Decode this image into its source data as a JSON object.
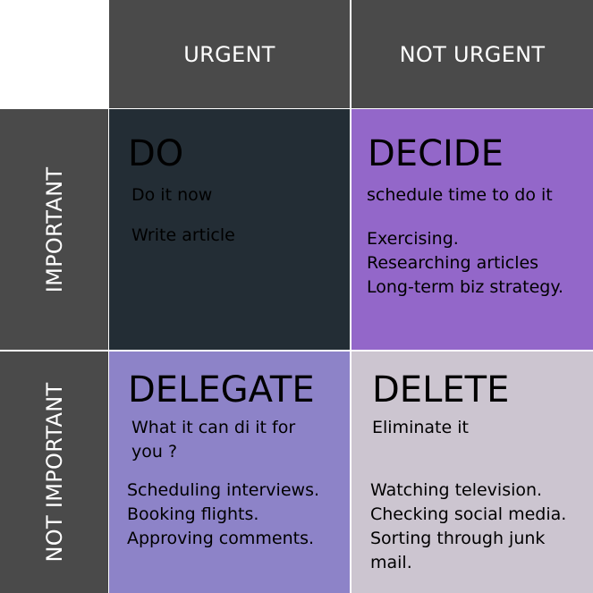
{
  "headers": {
    "urgent": "URGENT",
    "not_urgent": "NOT URGENT",
    "important": "IMPORTANT",
    "not_important": "NOT IMPORTANT"
  },
  "quadrants": {
    "do": {
      "title": "DO",
      "subtitle": "Do it now",
      "items": [
        "Write article"
      ]
    },
    "decide": {
      "title": "DECIDE",
      "subtitle": "schedule time to do it",
      "items": [
        "Exercising.",
        "Researching articles",
        "Long-term biz strategy."
      ]
    },
    "delegate": {
      "title": "DELEGATE",
      "subtitle": "What it can di it for you ?",
      "items": [
        "Scheduling interviews.",
        "Booking flights.",
        "Approving comments."
      ]
    },
    "delete": {
      "title": "DELETE",
      "subtitle": "Eliminate it",
      "items": [
        "Watching television.",
        "Checking social media.",
        "Sorting through junk",
        "mail."
      ]
    }
  },
  "colors": {
    "header_bg": "#4a4a4a",
    "do_bg": "#232d35",
    "decide_bg": "#9367c9",
    "delegate_bg": "#8d83c8",
    "delete_bg": "#ccc5d0"
  }
}
